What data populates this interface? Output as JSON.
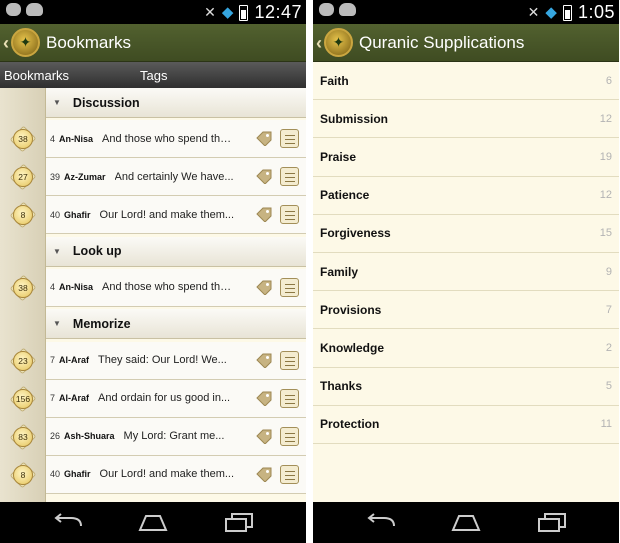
{
  "left": {
    "status": {
      "time": "12:47"
    },
    "title": "Bookmarks",
    "tabs": {
      "bookmarks": "Bookmarks",
      "tags": "Tags"
    },
    "groups": [
      {
        "name": "Discussion",
        "top": 0,
        "rows": [
          {
            "badge": "38",
            "ayah": "4",
            "surah": "An-Nisa",
            "text": "And those who spend thei..."
          },
          {
            "badge": "27",
            "ayah": "39",
            "surah": "Az-Zumar",
            "text": "And certainly We have..."
          },
          {
            "badge": "8",
            "ayah": "40",
            "surah": "Ghafir",
            "text": "Our Lord! and make them..."
          }
        ]
      },
      {
        "name": "Look up",
        "rows": [
          {
            "badge": "38",
            "ayah": "4",
            "surah": "An-Nisa",
            "text": "And those who spend thei..."
          }
        ]
      },
      {
        "name": "Memorize",
        "rows": [
          {
            "badge": "23",
            "ayah": "7",
            "surah": "Al-Araf",
            "text": "They said: Our Lord! We..."
          },
          {
            "badge": "156",
            "ayah": "7",
            "surah": "Al-Araf",
            "text": "And ordain for us good in...",
            "marked": true
          },
          {
            "badge": "83",
            "ayah": "26",
            "surah": "Ash-Shuara",
            "text": "My Lord: Grant me..."
          },
          {
            "badge": "8",
            "ayah": "40",
            "surah": "Ghafir",
            "text": "Our Lord! and make them..."
          }
        ]
      }
    ]
  },
  "right": {
    "status": {
      "time": "1:05"
    },
    "title": "Quranic Supplications",
    "categories": [
      {
        "name": "Faith",
        "count": "6"
      },
      {
        "name": "Submission",
        "count": "12"
      },
      {
        "name": "Praise",
        "count": "19"
      },
      {
        "name": "Patience",
        "count": "12"
      },
      {
        "name": "Forgiveness",
        "count": "15"
      },
      {
        "name": "Family",
        "count": "9"
      },
      {
        "name": "Provisions",
        "count": "7"
      },
      {
        "name": "Knowledge",
        "count": "2"
      },
      {
        "name": "Thanks",
        "count": "5"
      },
      {
        "name": "Protection",
        "count": "11"
      }
    ]
  },
  "colors": {
    "action_bar": "#4a5828",
    "list_bg": "#fdf9e7",
    "wifi": "#36a6e0"
  },
  "icons": [
    "back-chevron-icon",
    "quran-logo-icon",
    "tag-icon",
    "note-icon",
    "wifi-icon",
    "battery-icon",
    "nav-back-icon",
    "nav-home-icon",
    "nav-recent-icon"
  ]
}
